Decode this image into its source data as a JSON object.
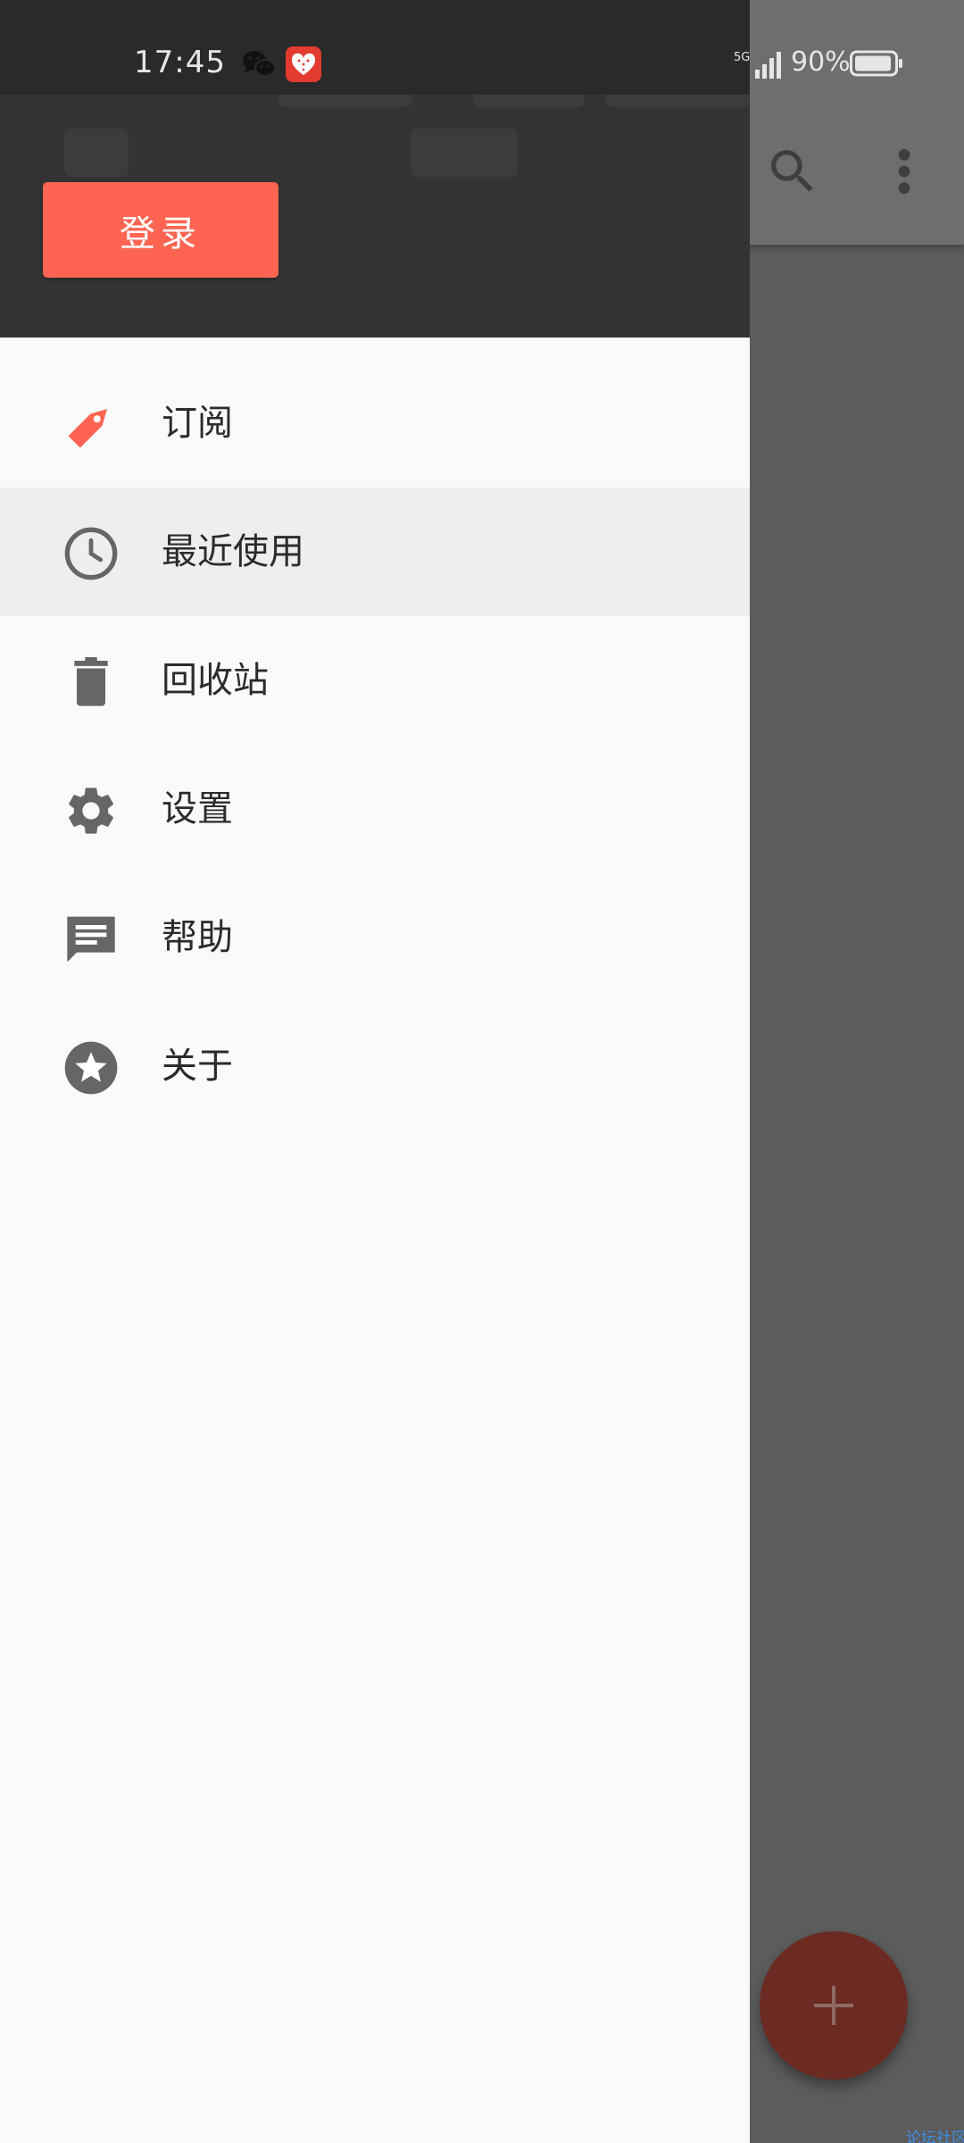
{
  "status_bar": {
    "time": "17:45",
    "battery_percent": "90%",
    "network": "5G",
    "icons": [
      "wechat-icon",
      "app-badge-icon",
      "signal-icon",
      "battery-icon"
    ]
  },
  "drawer": {
    "login_label": "登录",
    "menu": [
      {
        "label": "订阅",
        "icon": "tag-icon",
        "selected": false
      },
      {
        "label": "最近使用",
        "icon": "clock-icon",
        "selected": true
      },
      {
        "label": "回收站",
        "icon": "trash-icon",
        "selected": false
      },
      {
        "label": "设置",
        "icon": "gear-icon",
        "selected": false
      },
      {
        "label": "帮助",
        "icon": "feedback-icon",
        "selected": false
      },
      {
        "label": "关于",
        "icon": "star-icon",
        "selected": false
      }
    ]
  },
  "background_app": {
    "toolbar_icons": [
      "search-icon",
      "more-vert-icon"
    ],
    "fab_icon": "plus-icon",
    "watermark": "论坛社区"
  },
  "colors": {
    "accent": "#fd6552",
    "drawer_header": "#333333",
    "drawer_bg": "#fafafa",
    "selected_row": "#eeeeee",
    "icon_gray": "#666666",
    "scrim": "#5c5c5c",
    "fab_dimmed": "#6b2a22"
  }
}
